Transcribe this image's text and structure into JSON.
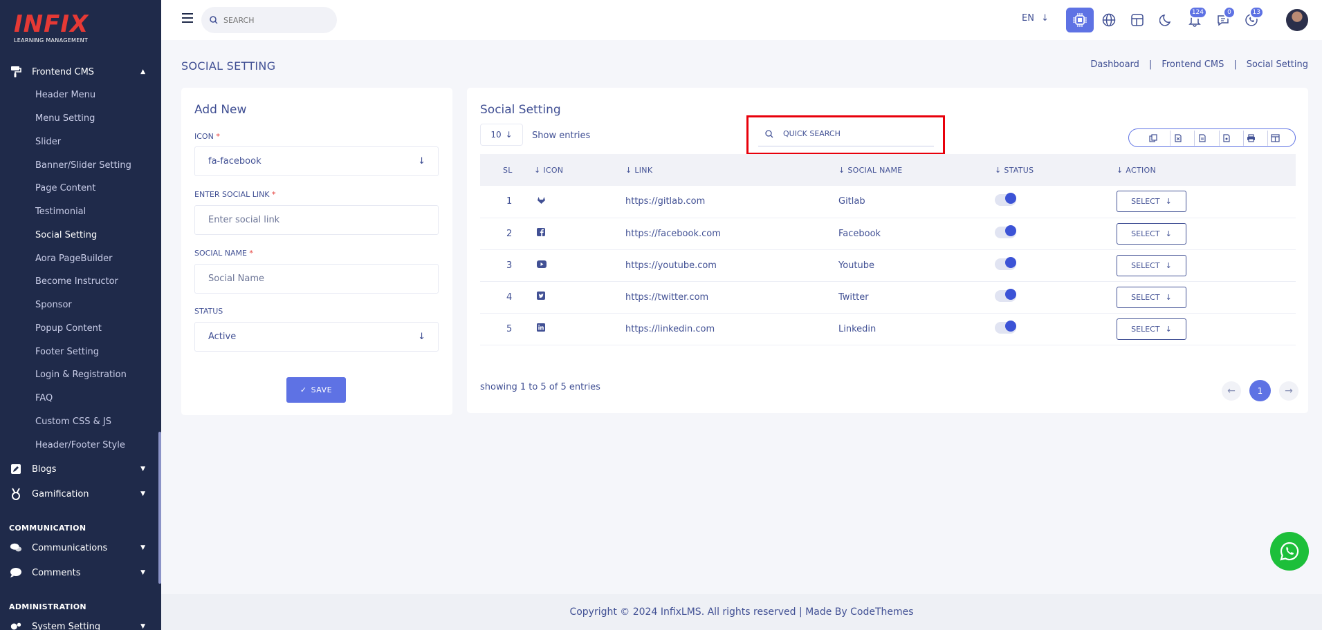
{
  "brand": {
    "name": "INFIX",
    "tagline": "LEARNING MANAGEMENT"
  },
  "sidebar": {
    "frontend_cms": "Frontend CMS",
    "items": [
      "Header Menu",
      "Menu Setting",
      "Slider",
      "Banner/Slider Setting",
      "Page Content",
      "Testimonial",
      "Social Setting",
      "Aora PageBuilder",
      "Become Instructor",
      "Sponsor",
      "Popup Content",
      "Footer Setting",
      "Login & Registration",
      "FAQ",
      "Custom CSS & JS",
      "Header/Footer Style"
    ],
    "active_item": "Social Setting",
    "blogs": "Blogs",
    "gamification": "Gamification",
    "section_communication": "COMMUNICATION",
    "communications": "Communications",
    "comments": "Comments",
    "section_administration": "ADMINISTRATION",
    "system_setting": "System Setting"
  },
  "header": {
    "search_placeholder": "SEARCH",
    "language": "EN",
    "notifications_count": "124",
    "messages_count": "0",
    "calls_count": "13"
  },
  "page": {
    "title": "SOCIAL SETTING",
    "breadcrumb": [
      "Dashboard",
      "Frontend CMS",
      "Social Setting"
    ]
  },
  "form": {
    "title": "Add New",
    "icon_label": "ICON",
    "icon_value": "fa-facebook",
    "link_label": "ENTER SOCIAL LINK",
    "link_placeholder": "Enter social link",
    "name_label": "SOCIAL NAME",
    "name_placeholder": "Social Name",
    "status_label": "STATUS",
    "status_value": "Active",
    "required_mark": "*",
    "save_label": "SAVE"
  },
  "list": {
    "title": "Social Setting",
    "entries_value": "10",
    "show_entries": "Show entries",
    "quick_search": "QUICK SEARCH",
    "columns": [
      "SL",
      "ICON",
      "LINK",
      "SOCIAL NAME",
      "STATUS",
      "ACTION"
    ],
    "rows": [
      {
        "sl": "1",
        "icon": "gitlab-icon",
        "link": "https://gitlab.com",
        "name": "Gitlab",
        "status": true
      },
      {
        "sl": "2",
        "icon": "facebook-icon",
        "link": "https://facebook.com",
        "name": "Facebook",
        "status": true
      },
      {
        "sl": "3",
        "icon": "youtube-icon",
        "link": "https://youtube.com",
        "name": "Youtube",
        "status": true
      },
      {
        "sl": "4",
        "icon": "twitter-icon",
        "link": "https://twitter.com",
        "name": "Twitter",
        "status": true
      },
      {
        "sl": "5",
        "icon": "linkedin-icon",
        "link": "https://linkedin.com",
        "name": "Linkedin",
        "status": true
      }
    ],
    "select_label": "SELECT",
    "showing_text": "showing 1 to 5 of 5 entries",
    "current_page": "1"
  },
  "footer": {
    "copyright": "Copyright © 2024 InfixLMS. All rights reserved | Made By CodeThemes"
  },
  "colors": {
    "primary": "#5e72e4",
    "sidebar": "#1f2a4a",
    "text": "#415094",
    "highlight": "#e8000b",
    "whatsapp": "#1dbf3a"
  }
}
